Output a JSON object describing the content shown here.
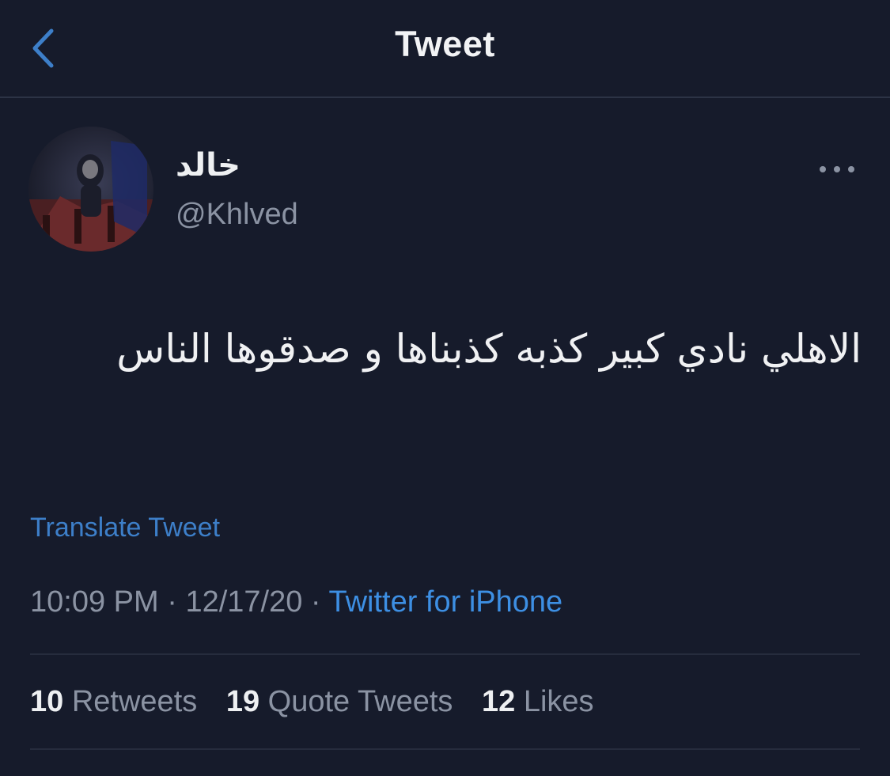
{
  "header": {
    "title": "Tweet",
    "back_icon": "chevron-left-icon"
  },
  "author": {
    "display_name": "خالد",
    "handle": "@Khlved",
    "avatar": "avatar-image"
  },
  "menu_icon": "more-horizontal-icon",
  "tweet": {
    "text": "الاهلي نادي كبير كذبه كذبناها و صدقوها الناس"
  },
  "translate_label": "Translate Tweet",
  "meta": {
    "time": "10:09 PM",
    "separator": "·",
    "date": "12/17/20",
    "source": "Twitter for iPhone"
  },
  "stats": {
    "retweets_count": "10",
    "retweets_label": "Retweets",
    "quotes_count": "19",
    "quotes_label": "Quote Tweets",
    "likes_count": "12",
    "likes_label": "Likes"
  },
  "colors": {
    "background": "#161b2b",
    "accent": "#3d8fe3",
    "muted_text": "#8b93a3"
  }
}
